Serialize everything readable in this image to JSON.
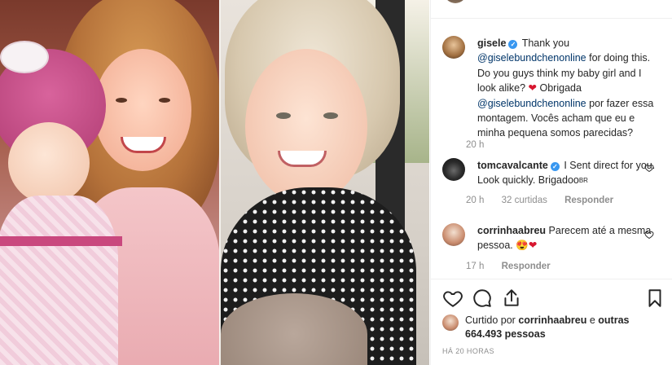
{
  "post": {
    "author": "gisele",
    "caption_parts": {
      "a": "Thank you ",
      "m1": "@giselebundchenonline",
      "b": " for doing this. Do you guys think my baby girl and I look alike? ",
      "c": " Obrigada ",
      "m2": "@giselebundchenonline",
      "d": " por fazer essa montagem. Vocês acham que eu e minha pequena somos parecidas?"
    },
    "caption_time": "20 h"
  },
  "comments": [
    {
      "username": "tomcavalcante",
      "verified": true,
      "text": "I Sent direct for you. Look quickly. Brigadoo",
      "flag": "BR",
      "time": "20 h",
      "likes": "32 curtidas",
      "reply": "Responder"
    },
    {
      "username": "corrinhaabreu",
      "verified": false,
      "text": "Parecem até a mesma pessoa. ",
      "time": "17 h",
      "reply": "Responder"
    }
  ],
  "liked_by": {
    "prefix": "Curtido por ",
    "user": "corrinhaabreu",
    "middle": " e ",
    "others": "outras 664.493 pessoas"
  },
  "posted_ago": "HÁ 20 HORAS",
  "icons": {
    "verified": "✓",
    "heart_emoji": "❤",
    "heart_eyes_emoji": "😍"
  },
  "colors": {
    "verified": "#3897f0",
    "mention": "#003569",
    "meta": "#8e8e8e",
    "heart": "#d7162f"
  }
}
